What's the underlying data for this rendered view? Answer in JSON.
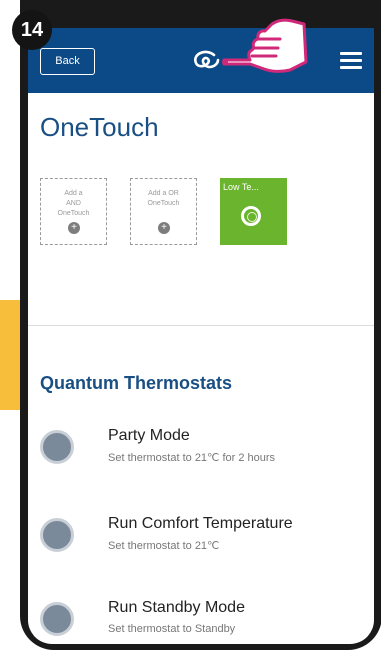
{
  "step_number": "14",
  "header": {
    "back_label": "Back"
  },
  "page_title": "OneTouch",
  "tiles": [
    {
      "label_line1": "Add a",
      "label_line2": "AND",
      "label_line3": "OneTouch"
    },
    {
      "label_line1": "Add a OR",
      "label_line2": "OneTouch"
    },
    {
      "label": "Low Te..."
    }
  ],
  "section_title": "Quantum Thermostats",
  "actions": [
    {
      "name": "Party Mode",
      "description": "Set thermostat to 21℃ for 2 hours"
    },
    {
      "name": "Run Comfort Temperature",
      "description": "Set thermostat to 21℃"
    },
    {
      "name": "Run Standby Mode",
      "description": "Set thermostat to Standby"
    }
  ],
  "colors": {
    "header": "#0b4a86",
    "title": "#1a4f84",
    "scene_tile": "#6bb42d",
    "arrow": "#f6be3b"
  }
}
